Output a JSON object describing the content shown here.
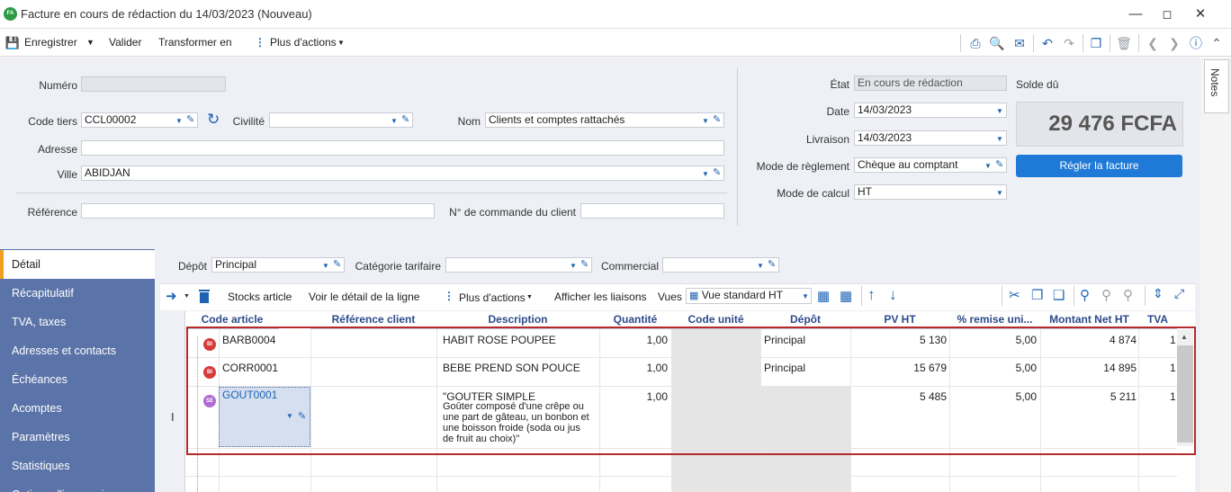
{
  "window": {
    "badge": "FA",
    "title": "Facture en cours de rédaction du 14/03/2023 (Nouveau)"
  },
  "toolbar": {
    "save": "Enregistrer",
    "validate": "Valider",
    "transform": "Transformer en",
    "more": "Plus d'actions"
  },
  "notes": "Notes",
  "form": {
    "numero_label": "Numéro",
    "numero": "",
    "code_tiers_label": "Code tiers",
    "code_tiers": "CCL00002",
    "civilite_label": "Civilité",
    "civilite": "",
    "nom_label": "Nom",
    "nom": "Clients et comptes rattachés",
    "adresse_label": "Adresse",
    "adresse": "",
    "ville_label": "Ville",
    "ville": "ABIDJAN",
    "reference_label": "Référence",
    "reference": "",
    "commande_label": "N° de commande du client",
    "commande": "",
    "etat_label": "État",
    "etat": "En cours de rédaction",
    "date_label": "Date",
    "date": "14/03/2023",
    "livraison_label": "Livraison",
    "livraison": "14/03/2023",
    "reglement_label": "Mode de règlement",
    "reglement": "Chèque au comptant",
    "calcul_label": "Mode de calcul",
    "calcul": "HT",
    "solde_label": "Solde dû",
    "solde": "29 476 FCFA",
    "regler_btn": "Régler la facture"
  },
  "nav": [
    "Détail",
    "Récapitulatif",
    "TVA, taxes",
    "Adresses et contacts",
    "Échéances",
    "Acomptes",
    "Paramètres",
    "Statistiques",
    "Options d'impression"
  ],
  "filters": {
    "depot_label": "Dépôt",
    "depot": "Principal",
    "categorie_label": "Catégorie tarifaire",
    "categorie": "",
    "commercial_label": "Commercial",
    "commercial": ""
  },
  "grid_toolbar": {
    "stocks": "Stocks article",
    "voir": "Voir le détail de la ligne",
    "more": "Plus d'actions",
    "liaisons": "Afficher les liaisons",
    "vues_label": "Vues",
    "vue": "Vue standard HT"
  },
  "columns": [
    "Code article",
    "Référence client",
    "Description",
    "Quantité",
    "Code unité",
    "Dépôt",
    "PV HT",
    "% remise uni...",
    "Montant Net HT",
    "TVA"
  ],
  "rows": [
    {
      "badge": "BI",
      "code": "BARB0004",
      "ref": "",
      "desc": "HABIT ROSE POUPEE",
      "qty": "1,00",
      "unit": "",
      "depot": "Principal",
      "pv": "5 130",
      "remise": "5,00",
      "montant": "4 874",
      "tva": "1"
    },
    {
      "badge": "BI",
      "code": "CORR0001",
      "ref": "",
      "desc": "BEBE PREND SON POUCE",
      "qty": "1,00",
      "unit": "",
      "depot": "Principal",
      "pv": "15 679",
      "remise": "5,00",
      "montant": "14 895",
      "tva": "1"
    },
    {
      "badge": "SE",
      "code": "GOUT0001",
      "ref": "",
      "desc": "\"GOUTER SIMPLE",
      "desc2": "Goûter composé d'une crêpe ou",
      "desc3": "une part de gâteau, un bonbon et",
      "desc4": "une boisson froide (soda ou jus",
      "desc5": "de fruit au choix)\"",
      "qty": "1,00",
      "unit": "",
      "depot": "",
      "pv": "5 485",
      "remise": "5,00",
      "montant": "5 211",
      "tva": "1"
    }
  ],
  "colors": {
    "nav": "#5a73a8",
    "accent": "#1e7ad6",
    "frame": "#b52b2b",
    "bi": "#d63b3b",
    "se": "#b06ad4"
  }
}
